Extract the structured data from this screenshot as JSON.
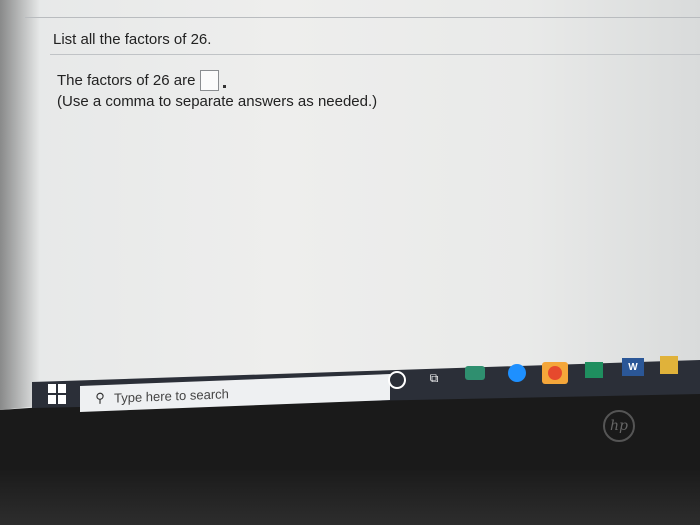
{
  "question": {
    "text": "List all the factors of 26."
  },
  "answer": {
    "prefix": "The factors of 26 are",
    "value": "",
    "hint": "(Use a comma to separate answers as needed.)"
  },
  "taskbar": {
    "search_placeholder": "Type here to search",
    "icons": [
      "windows-start-icon",
      "search-icon",
      "cortana-icon",
      "task-view-icon",
      "app-icon",
      "edge-icon",
      "chrome-icon",
      "store-icon",
      "word-icon",
      "file-explorer-icon"
    ],
    "task_view_glyph": "⧉",
    "word_glyph": "W"
  },
  "hardware": {
    "logo_text": "hp"
  },
  "colors": {
    "page_bg": "#eeeeed",
    "taskbar": "#2b2f38",
    "text": "#222222"
  }
}
